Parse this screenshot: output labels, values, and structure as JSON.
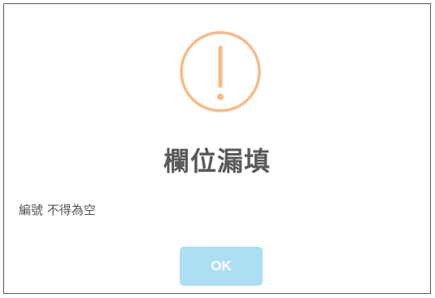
{
  "dialog": {
    "icon": "exclamation-warning-icon",
    "icon_color": "#f8bb86",
    "title": "欄位漏填",
    "message": "編號 不得為空",
    "ok_label": "OK",
    "ok_button_color": "#aedef4"
  }
}
